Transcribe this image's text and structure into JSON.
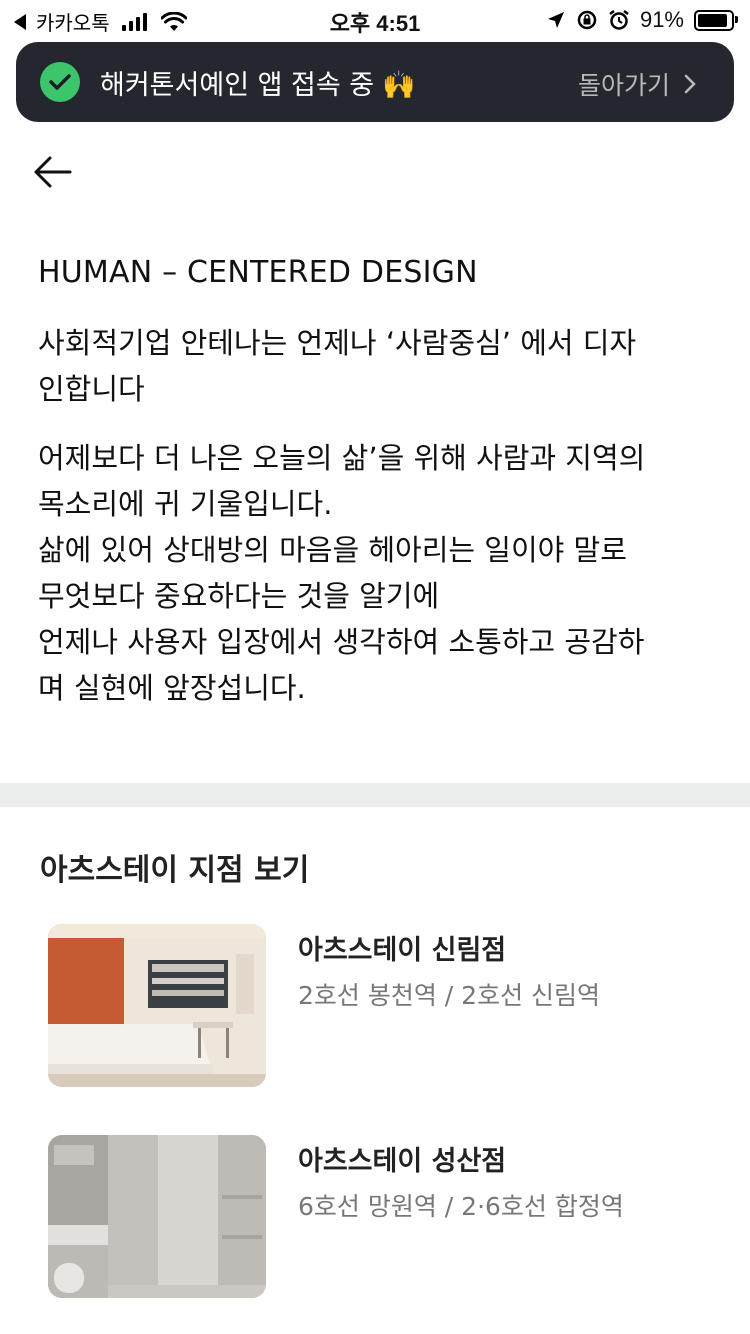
{
  "status_bar": {
    "carrier": "카카오톡",
    "time": "오후 4:51",
    "battery_percent": "91%",
    "battery_level": 0.91
  },
  "banner": {
    "message": "해커톤서예인 앱 접속 중",
    "emoji": "🙌",
    "return_label": "돌아가기",
    "accent_color": "#3cc56a"
  },
  "about": {
    "heading": "HUMAN – CENTERED DESIGN",
    "paragraph1_lines": [
      "사회적기업 안테나는 언제나 ‘사람중심’ 에서 디자",
      "인합니다"
    ],
    "paragraph2_lines": [
      "어제보다 더 나은 오늘의 삶’을 위해 사람과 지역의",
      "목소리에 귀 기울입니다.",
      "삶에 있어 상대방의 마음을 헤아리는 일이야 말로",
      "무엇보다 중요하다는 것을 알기에",
      "언제나 사용자 입장에서 생각하여 소통하고 공감하",
      "며 실현에 앞장섭니다."
    ]
  },
  "branches": {
    "title": "아츠스테이 지점 보기",
    "items": [
      {
        "name": "아츠스테이 신림점",
        "stations": "2호선 봉천역 / 2호선 신림역"
      },
      {
        "name": "아츠스테이 성산점",
        "stations": "6호선 망원역 / 2·6호선 합정역"
      }
    ]
  }
}
